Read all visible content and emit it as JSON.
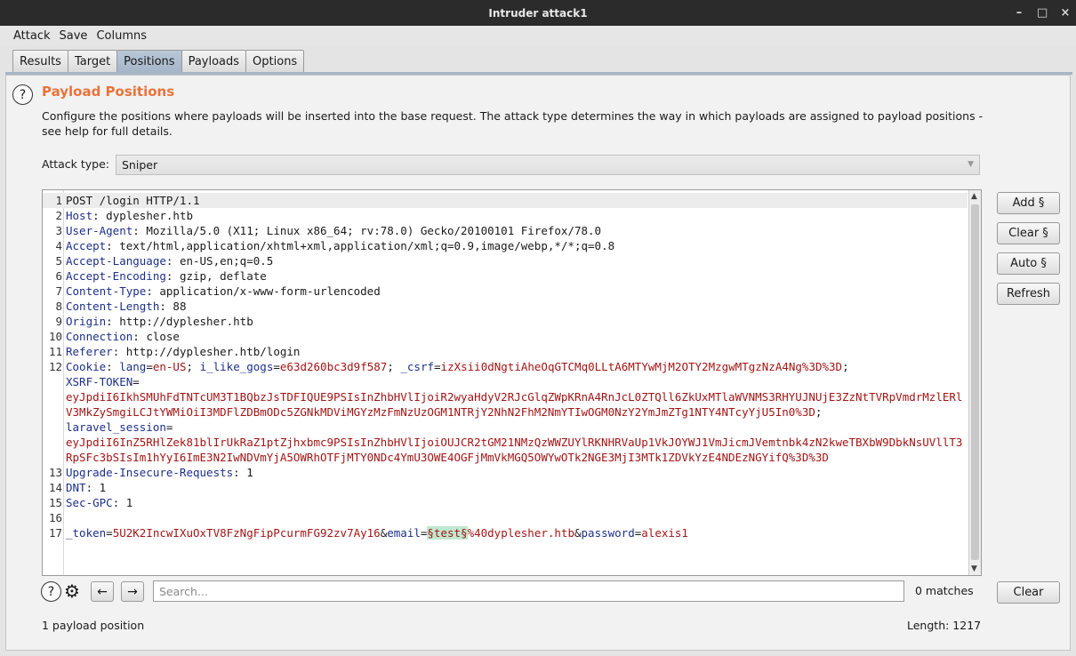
{
  "window": {
    "title": "Intruder attack1",
    "controls": [
      "–",
      "□",
      "×"
    ]
  },
  "menu": [
    "Attack",
    "Save",
    "Columns"
  ],
  "tabs": [
    "Results",
    "Target",
    "Positions",
    "Payloads",
    "Options"
  ],
  "active_tab": "Positions",
  "section": {
    "title": "Payload Positions",
    "description": "Configure the positions where payloads will be inserted into the base request. The attack type determines the way in which payloads are assigned to payload positions - see help for full details."
  },
  "attack_type": {
    "label": "Attack type:",
    "value": "Sniper"
  },
  "request": {
    "lines": [
      {
        "n": "1",
        "text": "POST /login HTTP/1.1"
      },
      {
        "n": "2",
        "key": "Host",
        "value": "dyplesher.htb"
      },
      {
        "n": "3",
        "key": "User-Agent",
        "value": "Mozilla/5.0 (X11; Linux x86_64; rv:78.0) Gecko/20100101 Firefox/78.0"
      },
      {
        "n": "4",
        "key": "Accept",
        "value": "text/html,application/xhtml+xml,application/xml;q=0.9,image/webp,*/*;q=0.8"
      },
      {
        "n": "5",
        "key": "Accept-Language",
        "value": "en-US,en;q=0.5"
      },
      {
        "n": "6",
        "key": "Accept-Encoding",
        "value": "gzip, deflate"
      },
      {
        "n": "7",
        "key": "Content-Type",
        "value": "application/x-www-form-urlencoded"
      },
      {
        "n": "8",
        "key": "Content-Length",
        "value": "88"
      },
      {
        "n": "9",
        "key": "Origin",
        "value": "http://dyplesher.htb"
      },
      {
        "n": "10",
        "key": "Connection",
        "value": "close"
      },
      {
        "n": "11",
        "key": "Referer",
        "value": "http://dyplesher.htb/login"
      },
      {
        "n": "12",
        "key": "Cookie",
        "cookies": [
          {
            "name": "lang",
            "value": "en-US"
          },
          {
            "name": "i_like_gogs",
            "value": "e63d260bc3d9f587"
          },
          {
            "name": "_csrf",
            "value": "izXsii0dNgtiAheOqGTCMq0LLtA6MTYwMjM2OTY2MzgwMTgzNzA4Ng%3D%3D"
          },
          {
            "name": "XSRF-TOKEN",
            "value": "eyJpdiI6IkhSMUhFdTNTcUM3T1BQbzJsTDFIQUE9PSIsInZhbHVlIjoiR2wyaHdyV2RJcGlqZWpKRnA4RnJcL0ZTQll6ZkUxMTlaWVNMS3RHYUJNUjE3ZzNtTVRpVmdrMzlERlV3MkZySmgiLCJtYWMiOiI3MDFlZDBmODc5ZGNkMDViMGYzMzFmNzUzOGM1NTRjY2NhN2FhM2NmYTIwOGM0NzY2YmJmZTg1NTY4NTcyYjU5In0%3D"
          },
          {
            "name": "laravel_session",
            "value": "eyJpdiI6InZ5RHlZek81blIrUkRaZ1ptZjhxbmc9PSIsInZhbHVlIjoiOUJCR2tGM21NMzQzWWZUYlRKNHRVaUp1VkJOYWJ1VmJicmJVemtnbk4zN2kweTBXbW9DbkNsUVllT3RpSFc3bSIsIm1hYyI6ImE3N2IwNDVmYjA5OWRhOTFjMTY0NDc4YmU3OWE4OGFjMmVkMGQ5OWYwOTk2NGE3MjI3MTk1ZDVkYzE4NDEzNGYifQ%3D%3D"
          }
        ]
      },
      {
        "n": "13",
        "key": "Upgrade-Insecure-Requests",
        "value": "1"
      },
      {
        "n": "14",
        "key": "DNT",
        "value": "1"
      },
      {
        "n": "15",
        "key": "Sec-GPC",
        "value": "1"
      },
      {
        "n": "16",
        "text": ""
      },
      {
        "n": "17",
        "body": [
          {
            "name": "_token",
            "value": "5U2K2IncwIXuOxTV8FzNgFipPcurmFG92zv7Ay16"
          },
          {
            "name": "email",
            "marker_value": "§test§",
            "value": "%40dyplesher.htb"
          },
          {
            "name": "password",
            "value": "alexis1"
          }
        ]
      }
    ]
  },
  "side_buttons": {
    "add": "Add §",
    "clear": "Clear §",
    "auto": "Auto §",
    "refresh": "Refresh"
  },
  "search": {
    "placeholder": "Search...",
    "matches": "0 matches",
    "clear": "Clear"
  },
  "status": {
    "positions": "1 payload position",
    "length": "Length: 1217"
  }
}
